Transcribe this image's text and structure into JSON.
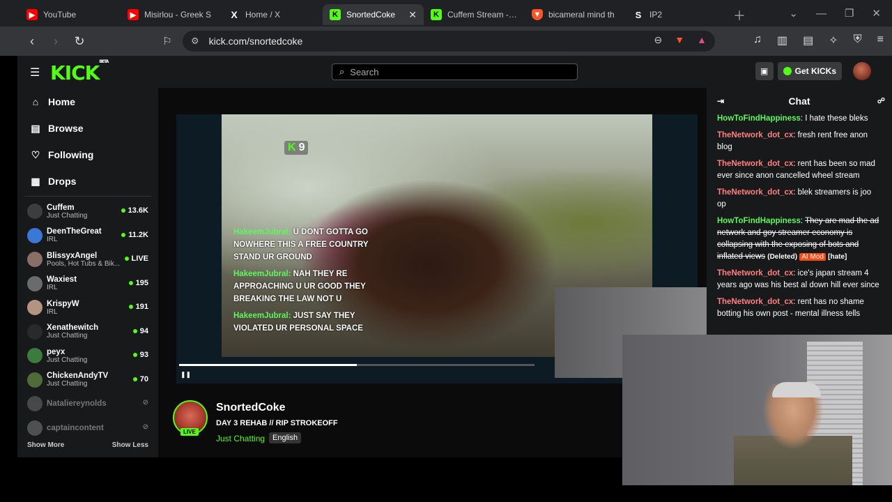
{
  "browser": {
    "tabs": [
      {
        "title": "YouTube",
        "favicon": "youtube-icon",
        "color": "#ff0000",
        "active": false
      },
      {
        "title": "Misirlou - Greek S",
        "favicon": "youtube-icon",
        "color": "#ff0000",
        "active": false
      },
      {
        "title": "Home / X",
        "favicon": "x-icon",
        "color": "#ffffff",
        "active": false
      },
      {
        "title": "SnortedCoke",
        "favicon": "kick-icon",
        "color": "#53fc18",
        "active": true
      },
      {
        "title": "Cuffem Stream - W",
        "favicon": "kick-icon",
        "color": "#53fc18",
        "active": false
      },
      {
        "title": "bicameral mind th",
        "favicon": "brave-icon",
        "color": "#fb542b",
        "active": false
      },
      {
        "title": "IP2",
        "favicon": "s-icon",
        "color": "#ffffff",
        "active": false
      }
    ],
    "url": "kick.com/snortedcoke"
  },
  "kick": {
    "search_placeholder": "Search",
    "get_kicks": "Get KICKs",
    "logo_text": "KICK",
    "logo_beta": "BETA"
  },
  "sidebar": {
    "nav": [
      {
        "label": "Home",
        "icon": "home-icon"
      },
      {
        "label": "Browse",
        "icon": "browse-icon"
      },
      {
        "label": "Following",
        "icon": "heart-icon"
      },
      {
        "label": "Drops",
        "icon": "drops-icon"
      }
    ],
    "channels": [
      {
        "name": "Cuffem",
        "category": "Just Chatting",
        "viewers": "13.6K",
        "live": true,
        "color": "#3d3d3d"
      },
      {
        "name": "DeenTheGreat",
        "category": "IRL",
        "viewers": "11.2K",
        "live": true,
        "color": "#3a78d8"
      },
      {
        "name": "BlissyxAngel",
        "category": "Pools, Hot Tubs & Bik...",
        "viewers": "LIVE",
        "live": true,
        "color": "#8a6f66"
      },
      {
        "name": "Waxiest",
        "category": "IRL",
        "viewers": "195",
        "live": true,
        "color": "#6b6b6b"
      },
      {
        "name": "KrispyW",
        "category": "IRL",
        "viewers": "191",
        "live": true,
        "color": "#b49480"
      },
      {
        "name": "Xenathewitch",
        "category": "Just Chatting",
        "viewers": "94",
        "live": true,
        "color": "#2a2a2a"
      },
      {
        "name": "peyx",
        "category": "Just Chatting",
        "viewers": "93",
        "live": true,
        "color": "#3d7a3d"
      },
      {
        "name": "ChickenAndyTV",
        "category": "Just Chatting",
        "viewers": "70",
        "live": true,
        "color": "#4f6b3a"
      },
      {
        "name": "Nataliereynolds",
        "category": "",
        "viewers": "",
        "live": false,
        "color": "#777777"
      },
      {
        "name": "captaincontent",
        "category": "",
        "viewers": "",
        "live": false,
        "color": "#888888"
      }
    ],
    "show_more": "Show More",
    "show_less": "Show Less"
  },
  "player": {
    "viewer_count": "9",
    "captions": [
      {
        "user": "HakeemJubral:",
        "text": " U DONT GOTTA GO NOWHERE THIS A FREE COUNTRY STAND UR GROUND"
      },
      {
        "user": "HakeemJubral:",
        "text": " NAH THEY RE APPROACHING U UR GOOD THEY BREAKING THE LAW NOT U"
      },
      {
        "user": "HakeemJubral:",
        "text": " JUST SAY THEY VIOLATED UR PERSONAL SPACE"
      }
    ],
    "progress": 0.5
  },
  "stream": {
    "name": "SnortedCoke",
    "title": "DAY 3 REHAB // RIP STROKEOFF",
    "category": "Just Chatting",
    "language": "English",
    "live_badge": "LIVE"
  },
  "chat": {
    "title": "Chat",
    "messages": [
      {
        "user": "HowToFindHappiness",
        "sep": ": ",
        "text": "I hate these bleks",
        "color": "g",
        "deleted": false
      },
      {
        "user": "TheNetwork_dot_cx",
        "sep": ": ",
        "text": "fresh rent free anon blog",
        "color": "r",
        "deleted": false
      },
      {
        "user": "TheNetwork_dot_cx",
        "sep": ": ",
        "text": "rent has been so mad ever since anon cancelled wheel stream",
        "color": "r",
        "deleted": false
      },
      {
        "user": "TheNetwork_dot_cx",
        "sep": ": ",
        "text": "blek streamers is joo op",
        "color": "r",
        "deleted": false
      },
      {
        "user": "HowToFindHappiness",
        "sep": ": ",
        "text": "They are mad the ad network and goy streamer economy is collapsing with the exposing of bots and inflated views",
        "color": "g",
        "deleted": true,
        "deleted_label": "(Deleted)",
        "mod_label": "AI Mod",
        "reason": "[hate]"
      },
      {
        "user": "TheNetwork_dot_cx",
        "sep": ": ",
        "text": "ice's japan stream 4 years ago was his best al down hill ever since",
        "color": "r",
        "deleted": false
      },
      {
        "user": "TheNetwork_dot_cx",
        "sep": ": ",
        "text": "rent has no shame botting his own post - mental illness tells",
        "color": "r",
        "deleted": false
      }
    ]
  }
}
